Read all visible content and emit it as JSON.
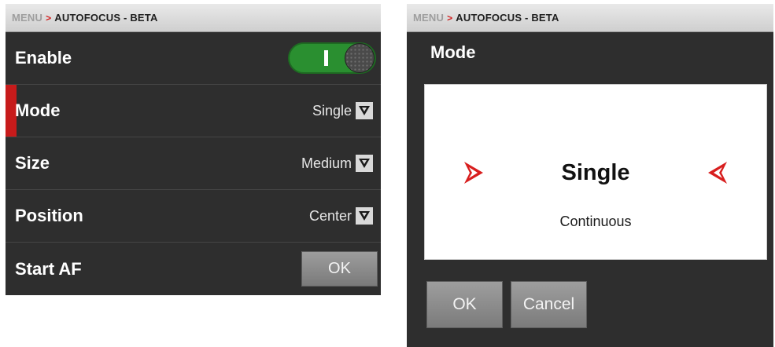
{
  "left": {
    "breadcrumb": {
      "menu": "MENU",
      "separator": ">",
      "current": "AUTOFOCUS - BETA"
    },
    "rows": [
      {
        "label": "Enable",
        "control": "toggle",
        "toggle_on": true
      },
      {
        "label": "Mode",
        "value": "Single",
        "selected": true
      },
      {
        "label": "Size",
        "value": "Medium"
      },
      {
        "label": "Position",
        "value": "Center"
      },
      {
        "label": "Start AF",
        "button": "OK"
      }
    ]
  },
  "right": {
    "breadcrumb": {
      "menu": "MENU",
      "separator": ">",
      "current": "AUTOFOCUS - BETA"
    },
    "title": "Mode",
    "picker": {
      "selected": "Single",
      "next": "Continuous"
    },
    "buttons": {
      "ok": "OK",
      "cancel": "Cancel"
    }
  },
  "colors": {
    "accent_red": "#c71b1b",
    "toggle_green": "#2a8f30",
    "panel_bg": "#2e2e2e"
  },
  "icons": [
    "chevron-down-icon",
    "arrow-right-icon",
    "arrow-left-icon"
  ]
}
